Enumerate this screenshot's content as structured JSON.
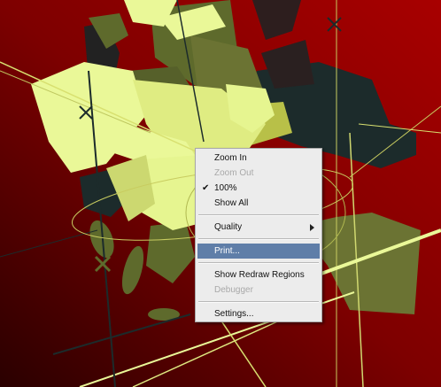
{
  "context_menu": {
    "items": [
      {
        "label": "Zoom In",
        "enabled": true
      },
      {
        "label": "Zoom Out",
        "enabled": false
      },
      {
        "label": "100%",
        "enabled": true,
        "checked": true
      },
      {
        "label": "Show All",
        "enabled": true
      },
      {
        "label": "Quality",
        "enabled": true,
        "submenu": true
      },
      {
        "label": "Print...",
        "enabled": true,
        "highlighted": true
      },
      {
        "label": "Show Redraw Regions",
        "enabled": true
      },
      {
        "label": "Debugger",
        "enabled": false
      },
      {
        "label": "Settings...",
        "enabled": true
      }
    ]
  },
  "icons": {
    "check": "checkmark-icon",
    "submenu": "submenu-arrow-icon"
  },
  "colors": {
    "background_dark": "#2a0000",
    "background_red": "#a00000",
    "pale_yellow": "#eaf898",
    "olive": "#5e6a2c",
    "dark_teal": "#1c2b2b",
    "menu_bg": "#ececec",
    "menu_highlight": "#5f7ea8"
  }
}
